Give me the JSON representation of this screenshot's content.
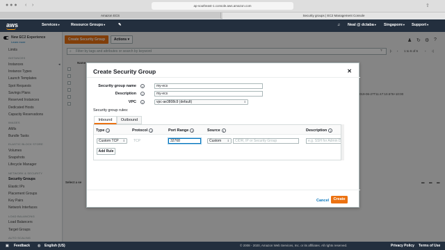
{
  "browser": {
    "url": "ap-southeast-1.console.aws.amazon.com",
    "tabs": [
      "Amazon ECS",
      "Security groups | EC2 Management Console"
    ]
  },
  "aws_nav": {
    "logo": "aws",
    "services": "Services",
    "resource_groups": "Resource Groups",
    "user": "Neal @ dctaba",
    "region": "Singapore",
    "support": "Support"
  },
  "sidebar": {
    "toggle_label": "New EC2 Experience",
    "learn_more": "Learn more",
    "items": [
      {
        "type": "item",
        "label": "Limits"
      },
      {
        "type": "head",
        "label": "INSTANCES"
      },
      {
        "type": "item",
        "label": "Instances"
      },
      {
        "type": "item",
        "label": "Instance Types"
      },
      {
        "type": "item",
        "label": "Launch Templates"
      },
      {
        "type": "item",
        "label": "Spot Requests"
      },
      {
        "type": "item",
        "label": "Savings Plans"
      },
      {
        "type": "item",
        "label": "Reserved Instances"
      },
      {
        "type": "item",
        "label": "Dedicated Hosts"
      },
      {
        "type": "item",
        "label": "Capacity Reservations"
      },
      {
        "type": "head",
        "label": "IMAGES"
      },
      {
        "type": "item",
        "label": "AMIs"
      },
      {
        "type": "item",
        "label": "Bundle Tasks"
      },
      {
        "type": "head",
        "label": "ELASTIC BLOCK STORE"
      },
      {
        "type": "item",
        "label": "Volumes"
      },
      {
        "type": "item",
        "label": "Snapshots"
      },
      {
        "type": "item",
        "label": "Lifecycle Manager"
      },
      {
        "type": "head",
        "label": "NETWORK & SECURITY"
      },
      {
        "type": "item",
        "label": "Security Groups",
        "active": true
      },
      {
        "type": "item",
        "label": "Elastic IPs"
      },
      {
        "type": "item",
        "label": "Placement Groups"
      },
      {
        "type": "item",
        "label": "Key Pairs"
      },
      {
        "type": "item",
        "label": "Network Interfaces"
      },
      {
        "type": "head",
        "label": "LOAD BALANCING"
      },
      {
        "type": "item",
        "label": "Load Balancers"
      },
      {
        "type": "item",
        "label": "Target Groups"
      },
      {
        "type": "head",
        "label": "AUTO SCALING"
      }
    ]
  },
  "main": {
    "create_sg_button": "Create Security Group",
    "actions_button": "Actions",
    "filter_placeholder": "Filter by tags and attributes or search by keyword",
    "pagination": "1 to 6 of 6",
    "col_name": "Name",
    "partial_date": "019-06-27T11:47:10.576+10:00",
    "partial_select": "Select a se"
  },
  "modal": {
    "title": "Create Security Group",
    "fields": {
      "name_label": "Security group name",
      "name_value": "my-ecs",
      "desc_label": "Description",
      "desc_value": "my-ecs",
      "vpc_label": "VPC",
      "vpc_value": "vpc-ae3808c9 (default)"
    },
    "rules_label": "Security group rules:",
    "tabs": [
      "Inbound",
      "Outbound"
    ],
    "columns": {
      "type": "Type",
      "protocol": "Protocol",
      "port_range": "Port Range",
      "source": "Source",
      "description": "Description"
    },
    "rule": {
      "type": "Custom TCP",
      "protocol": "TCP",
      "port_range": "32768",
      "source": "Custom",
      "source_placeholder": "CIDR, IP or Security Group",
      "description_placeholder": "e.g. SSH for Admin D"
    },
    "add_rule": "Add Rule",
    "cancel": "Cancel",
    "create": "Create"
  },
  "footer": {
    "feedback": "Feedback",
    "language": "English (US)",
    "copyright": "© 2008 - 2020, Amazon Web Services, Inc. or its affiliates. All rights reserved.",
    "privacy": "Privacy Policy",
    "terms": "Terms of Use"
  },
  "colors": {
    "aws_nav_bg": "#232f3e",
    "accent_orange": "#ec7211",
    "link_blue": "#0073bb"
  }
}
